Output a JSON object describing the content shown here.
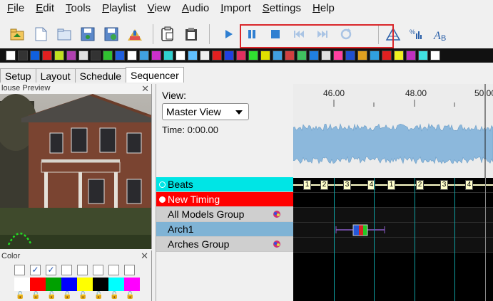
{
  "menu": [
    {
      "underline": "F",
      "rest": "ile"
    },
    {
      "underline": "E",
      "rest": "dit"
    },
    {
      "underline": "T",
      "rest": "ools"
    },
    {
      "underline": "P",
      "rest": "laylist"
    },
    {
      "underline": "V",
      "rest": "iew"
    },
    {
      "underline": "A",
      "rest": "udio"
    },
    {
      "underline": "I",
      "rest": "mport"
    },
    {
      "underline": "S",
      "rest": "ettings"
    },
    {
      "underline": "H",
      "rest": "elp"
    }
  ],
  "toolbar": {
    "file_icons": [
      "open-folder-icon",
      "new-file-icon",
      "open-icon",
      "save-icon",
      "save-as-icon",
      "render-icon"
    ],
    "edit_icons": [
      "paste-icon",
      "clipboard-icon"
    ],
    "playback_icons": [
      "play-icon",
      "pause-icon",
      "stop-icon",
      "rewind-icon",
      "fast-forward-icon",
      "loop-icon"
    ],
    "view_icons": [
      "tree-icon",
      "vu-meter-icon",
      "text-icon"
    ]
  },
  "tabs": [
    {
      "label": "Setup",
      "active": false
    },
    {
      "label": "Layout",
      "active": false
    },
    {
      "label": "Schedule",
      "active": false
    },
    {
      "label": "Sequencer",
      "active": true
    }
  ],
  "house_preview": {
    "title": "louse Preview"
  },
  "color_panel": {
    "title": "Color",
    "checkboxes": [
      false,
      true,
      true,
      false,
      false,
      false,
      false,
      false
    ],
    "swatches": [
      "#ffffff",
      "#ff0000",
      "#00a000",
      "#0000ff",
      "#ffff00",
      "#000000",
      "#00ffff",
      "#ff00ff"
    ]
  },
  "sequencer": {
    "view_label": "View:",
    "view_value": "Master View",
    "time_label": "Time: 0:00.00"
  },
  "rows": [
    {
      "label": "Beats",
      "bg": "#00e5e5",
      "color": "#000",
      "dot": true,
      "dot_color": "#ffffff",
      "dot_fill": "#00e5e5",
      "icon": false
    },
    {
      "label": "New Timing",
      "bg": "#ff0000",
      "color": "#ffffff",
      "dot": true,
      "dot_color": "#ffffff",
      "dot_fill": "#ffffff",
      "icon": false
    },
    {
      "label": "All Models Group",
      "bg": "#cfcfcf",
      "color": "#000",
      "dot": false,
      "icon": true
    },
    {
      "label": "Arch1",
      "bg": "#7fb3d5",
      "color": "#000",
      "dot": false,
      "icon": false
    },
    {
      "label": "Arches Group",
      "bg": "#cfcfcf",
      "color": "#000",
      "dot": false,
      "icon": true
    }
  ],
  "ruler": {
    "labels": [
      "46.00",
      "48.00",
      "50.00"
    ]
  },
  "beats": [
    "1",
    "2",
    "3",
    "4",
    "1",
    "2",
    "3",
    "4"
  ]
}
